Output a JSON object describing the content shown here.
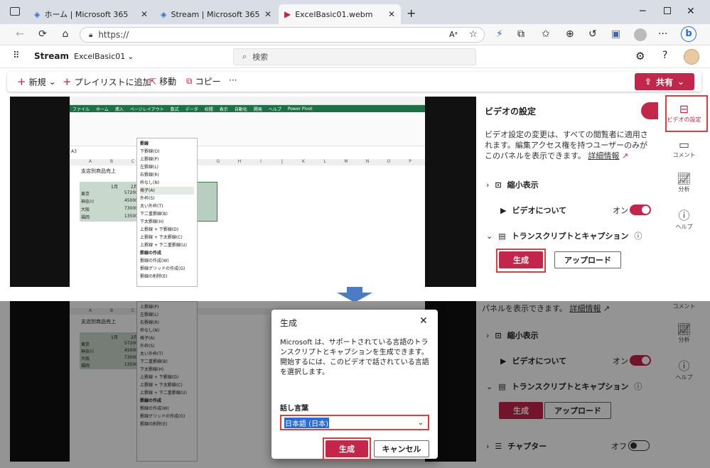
{
  "browser": {
    "tabs": [
      {
        "label": "ホーム | Microsoft 365"
      },
      {
        "label": "Stream | Microsoft 365"
      },
      {
        "label": "ExcelBasic01.webm"
      }
    ],
    "url": "https://"
  },
  "app": {
    "name": "Stream",
    "file": "ExcelBasic01",
    "search_placeholder": "検索"
  },
  "cmdbar": {
    "new": "新規",
    "add_playlist": "プレイリストに追加",
    "move": "移動",
    "copy": "コピー",
    "more": "···",
    "share": "共有"
  },
  "excel": {
    "tabs": [
      "ファイル",
      "ホーム",
      "挿入",
      "ページレイアウト",
      "数式",
      "データ",
      "校閲",
      "表示",
      "自動化",
      "開発",
      "ヘルプ",
      "Power Pivot"
    ],
    "cell_ref": "A3",
    "title": "支店別商品売上",
    "headers": [
      "1月",
      "2月"
    ],
    "rows": [
      {
        "name": "東京",
        "v": "57200"
      },
      {
        "name": "神奈川",
        "v": "45000"
      },
      {
        "name": "大阪",
        "v": "73000"
      },
      {
        "name": "福岡",
        "v": "13500"
      }
    ],
    "cols": [
      "A",
      "B",
      "C",
      "D",
      "E",
      "F",
      "G",
      "H",
      "I",
      "J",
      "K",
      "L",
      "M",
      "N",
      "O",
      "P"
    ],
    "menu_title": "罫線",
    "menu": [
      "下罫線(O)",
      "上罫線(P)",
      "左罫線(L)",
      "右罫線(R)",
      "枠なし(N)",
      "格子(A)",
      "外枠(S)",
      "太い外枠(T)",
      "下二重罫線(B)",
      "下太罫線(H)",
      "上罫線 + 下罫線(D)",
      "上罫線 + 下太罫線(C)",
      "上罫線 + 下二重罫線(U)"
    ],
    "menu2_title": "罫線の作成",
    "menu2": [
      "罫線の作成(W)",
      "罫線グリッドの作成(G)",
      "罫線の削除(E)"
    ]
  },
  "settings": {
    "title": "ビデオの設定",
    "desc": "ビデオ設定の変更は、すべての閲覧者に適用されます。編集アクセス権を持つユーザーのみがこのパネルを表示できます。",
    "learn_more": "詳細情報",
    "thumbnail": "縮小表示",
    "about": "ビデオについて",
    "about_state": "オン",
    "transcript": "トランスクリプトとキャプション",
    "generate": "生成",
    "upload": "アップロード",
    "chapters": "チャプター",
    "chapters_state": "オフ"
  },
  "rail": [
    {
      "label": "ビデオの設定",
      "icon": "settings-icon"
    },
    {
      "label": "コメント",
      "icon": "comment-icon"
    },
    {
      "label": "分析",
      "icon": "analytics-icon"
    },
    {
      "label": "ヘルプ",
      "icon": "help-icon"
    }
  ],
  "bottom_panel": {
    "desc_tail": "パネルを表示できます。",
    "learn_more": "詳細情報"
  },
  "dialog": {
    "title": "生成",
    "body": "Microsoft は、サポートされている言語のトランスクリプトとキャプションを生成できます。開始するには、このビデオで話されている言語を選択します。",
    "lang_label": "話し言葉",
    "lang_value": "日本語 (日本)",
    "generate": "生成",
    "cancel": "キャンセル"
  },
  "colors": {
    "accent": "#c4254a",
    "highlight": "#e23c3c",
    "arrow": "#4a7cc4",
    "excel_green": "#1e7145"
  }
}
